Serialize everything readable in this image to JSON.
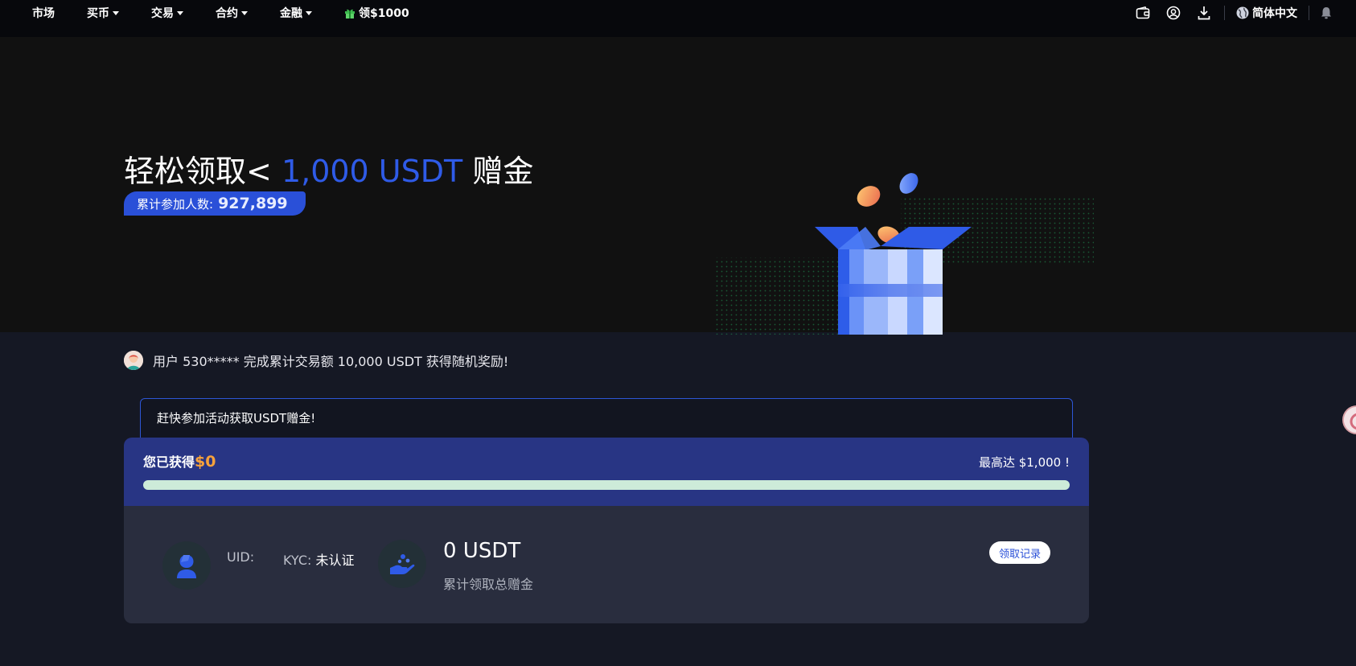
{
  "nav": {
    "items": [
      {
        "label": "市场",
        "has_dropdown": false
      },
      {
        "label": "买币",
        "has_dropdown": true
      },
      {
        "label": "交易",
        "has_dropdown": true
      },
      {
        "label": "合约",
        "has_dropdown": true
      },
      {
        "label": "金融",
        "has_dropdown": true
      }
    ],
    "promo_label": "领$1000",
    "language": "简体中文",
    "icons": [
      "wallet-icon",
      "user-icon",
      "download-icon",
      "globe-icon",
      "bell-icon"
    ]
  },
  "hero": {
    "title_prefix": "轻松领取<",
    "title_highlight": "1,000 USDT",
    "title_suffix": "赠金",
    "participants_label": "累计参加人数:",
    "participants_count": "927,899"
  },
  "ticker": {
    "message": "用户 530***** 完成累计交易额 10,000 USDT 获得随机奖励!"
  },
  "tip": {
    "text": "赶快参加活动获取USDT赠金!"
  },
  "progress_card": {
    "earned_label": "您已获得",
    "earned_amount": "$0",
    "max_label": "最高达 $1,000 !",
    "progress_fraction": 0
  },
  "account": {
    "uid_label": "UID:",
    "kyc_label": "KYC:",
    "kyc_status": "未认证",
    "total_amount": "0 USDT",
    "total_label": "累计领取总赠金",
    "records_button": "领取记录"
  },
  "colors": {
    "accent_blue": "#2f5be7",
    "progress_band": "#283584",
    "earned_amount": "#f7a23b",
    "progress_track": "#cdebd9"
  }
}
